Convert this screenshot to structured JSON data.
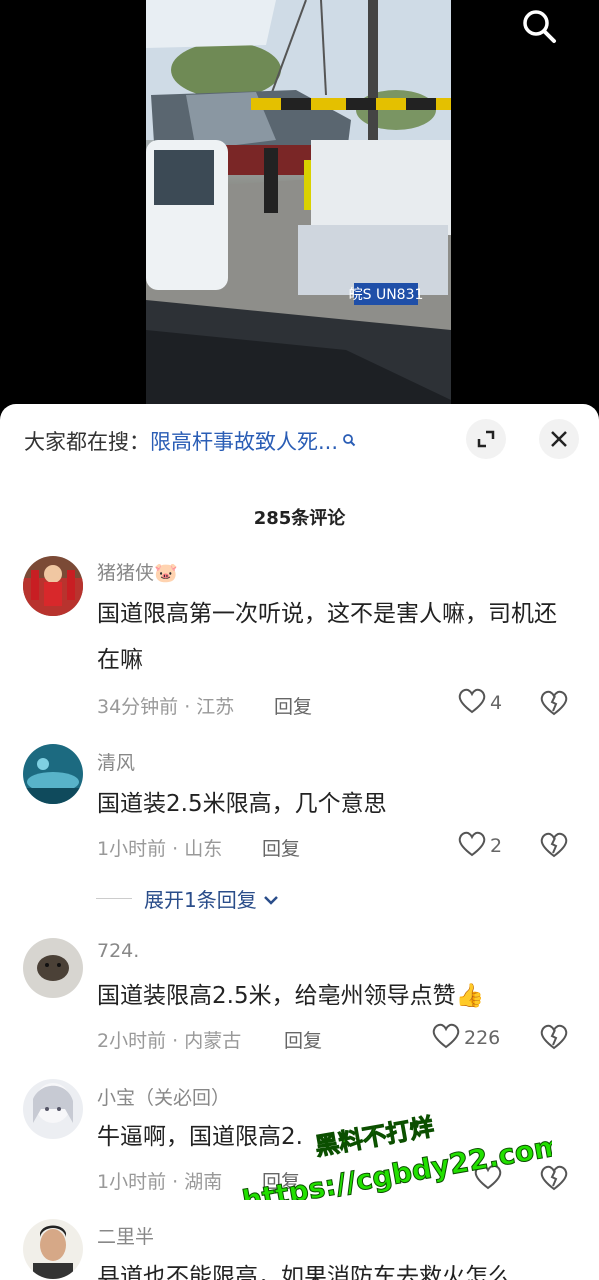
{
  "video": {
    "search_icon": "search-icon",
    "plate_text": "皖S UN831"
  },
  "sheet": {
    "hot_search_prefix": "大家都在搜：",
    "hot_search_query": "限高杆事故致人死...",
    "expand_icon": "expand-icon",
    "close_icon": "close-icon",
    "comment_count_title": "285条评论"
  },
  "comments": [
    {
      "username": "猪猪侠🐷",
      "text": "国道限高第一次听说，这不是害人嘛，司机还在嘛",
      "time_location": "34分钟前 · 江苏",
      "reply_label": "回复",
      "likes": "4"
    },
    {
      "username": "清风",
      "text": "国道装2.5米限高，几个意思",
      "time_location": "1小时前 · 山东",
      "reply_label": "回复",
      "likes": "2",
      "expand_replies": "展开1条回复"
    },
    {
      "username": "724.",
      "text": "国道装限高2.5米，给亳州领导点赞👍",
      "time_location": "2小时前 · 内蒙古",
      "reply_label": "回复",
      "likes": "226"
    },
    {
      "username": "小宝（关必回）",
      "text": "牛逼啊，国道限高2.",
      "time_location": "1小时前 · 湖南",
      "reply_label": "回复",
      "likes": ""
    },
    {
      "username": "二里半",
      "text": "县道也不能限高，如果消防车去救火怎么",
      "time_location": "",
      "reply_label": "",
      "likes": ""
    }
  ],
  "watermark": {
    "line1": "黑料不打烊",
    "line2": "https://cgbdy22.com"
  },
  "colors": {
    "link_blue": "#2a5db5",
    "watermark_green": "#22e000"
  }
}
